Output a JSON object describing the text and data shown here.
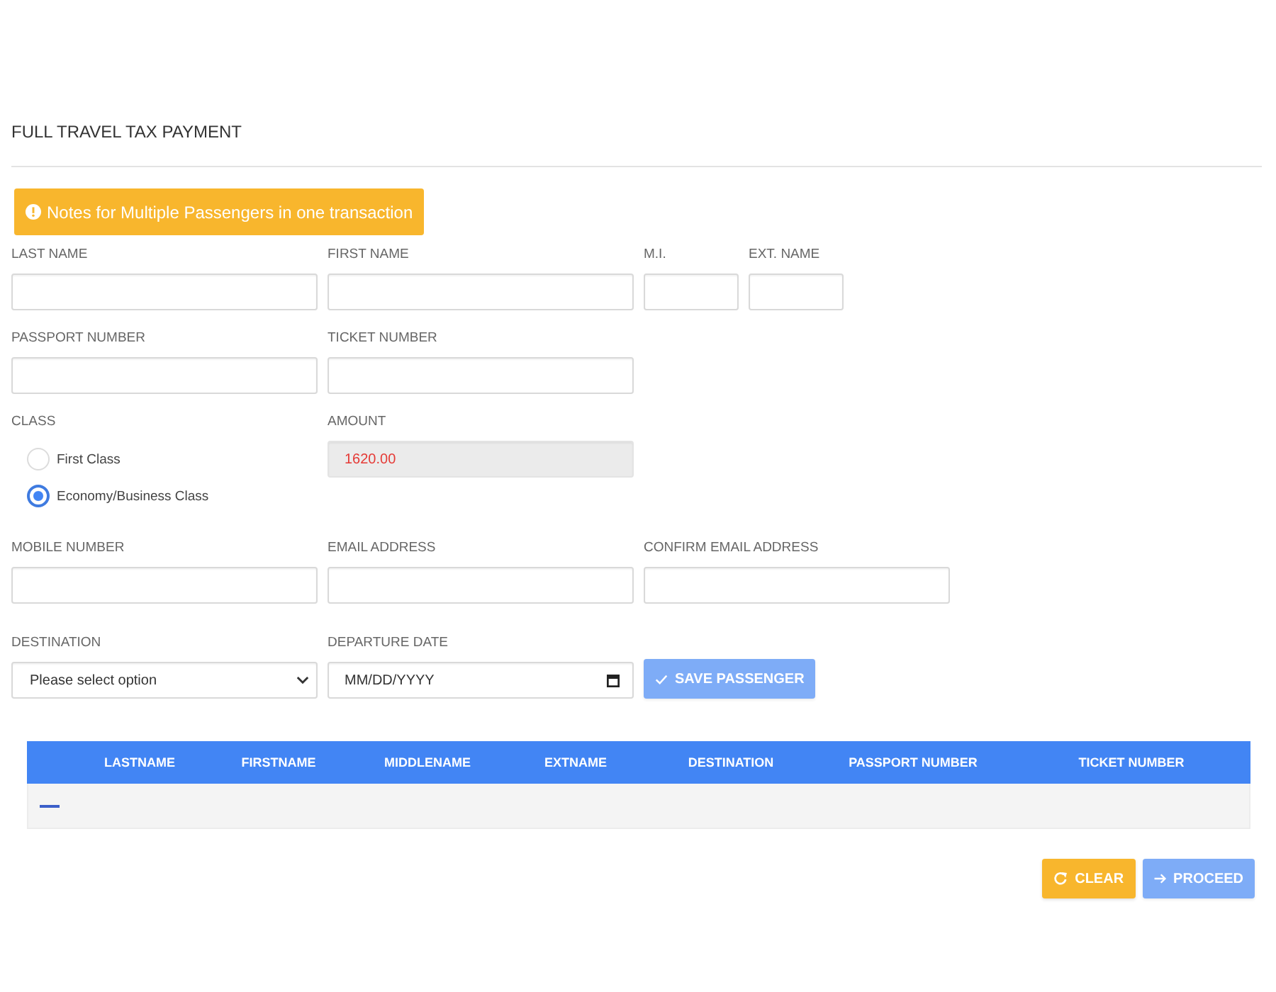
{
  "page_title": "FULL TRAVEL TAX PAYMENT",
  "notes_button": {
    "label": "Notes for Multiple Passengers in one transaction"
  },
  "form_rows": [
    [
      {
        "kind": "text",
        "label": "LAST NAME",
        "readonly": false
      },
      {
        "kind": "text",
        "label": "FIRST NAME",
        "readonly": false
      },
      {
        "kind": "short",
        "label": "M.I.",
        "readonly": false
      },
      {
        "kind": "short",
        "label": "EXT. NAME",
        "readonly": false
      }
    ],
    [
      {
        "kind": "text",
        "label": "PASSPORT NUMBER",
        "readonly": false
      },
      {
        "kind": "text",
        "label": "TICKET NUMBER",
        "readonly": false
      }
    ],
    [
      {
        "kind": "radio",
        "label": "CLASS",
        "options": [
          {
            "label": "First Class",
            "selected": false
          },
          {
            "label": "Economy/Business Class",
            "selected": true
          }
        ]
      },
      {
        "kind": "text",
        "label": "AMOUNT",
        "value": "1620.00",
        "readonly": true
      }
    ],
    [
      {
        "kind": "text",
        "label": "MOBILE NUMBER",
        "readonly": false
      },
      {
        "kind": "text",
        "label": "EMAIL ADDRESS",
        "readonly": false
      },
      {
        "kind": "text",
        "label": "CONFIRM EMAIL ADDRESS",
        "readonly": false
      }
    ],
    [
      {
        "kind": "select",
        "label": "DESTINATION",
        "value": "Please select option"
      },
      {
        "kind": "date",
        "label": "DEPARTURE DATE",
        "placeholder": "MM/DD/YYYY"
      },
      {
        "kind": "save",
        "label": "SAVE PASSENGER",
        "disabled": true
      }
    ]
  ],
  "passenger_table": {
    "columns": [
      "LASTNAME",
      "FIRSTNAME",
      "MIDDLENAME",
      "EXTNAME",
      "DESTINATION",
      "PASSPORT NUMBER",
      "TICKET NUMBER"
    ]
  },
  "actions": [
    {
      "kind": "clear",
      "label": "CLEAR",
      "disabled": false
    },
    {
      "kind": "proceed",
      "label": "PROCEED",
      "disabled": true
    }
  ]
}
